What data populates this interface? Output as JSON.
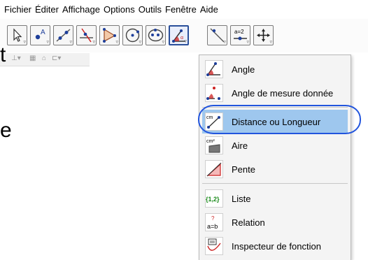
{
  "menubar": {
    "items": [
      "Fichier",
      "Éditer",
      "Affichage",
      "Options",
      "Outils",
      "Fenêtre",
      "Aide"
    ]
  },
  "toolbar": {
    "tools": [
      {
        "name": "move-tool-button",
        "icon": "cursor-arrow-icon"
      },
      {
        "name": "point-tool-button",
        "icon": "point-A-icon"
      },
      {
        "name": "line-tool-button",
        "icon": "line-icon"
      },
      {
        "name": "perpendicular-tool-button",
        "icon": "perpendicular-icon"
      },
      {
        "name": "polygon-tool-button",
        "icon": "polygon-icon"
      },
      {
        "name": "circle-tool-button",
        "icon": "circle-icon"
      },
      {
        "name": "conic-tool-button",
        "icon": "ellipse-icon"
      },
      {
        "name": "angle-tool-button",
        "icon": "angle-icon",
        "selected": true
      },
      {
        "name": "reflect-tool-button",
        "icon": "reflect-icon"
      },
      {
        "name": "slider-tool-button",
        "icon": "slider-icon",
        "text": "a=2"
      },
      {
        "name": "move-view-tool-button",
        "icon": "move-graphics-view-icon"
      }
    ]
  },
  "fragments": {
    "t": "t",
    "e": "e"
  },
  "dropdown": {
    "items": [
      {
        "label": "Angle",
        "icon": "angle-icon"
      },
      {
        "label": "Angle de mesure donnée",
        "icon": "angle-given-size-icon"
      },
      {
        "label": "Distance ou Longueur",
        "icon": "distance-length-icon",
        "icon_text": "cm",
        "highlighted": true
      },
      {
        "label": "Aire",
        "icon": "area-icon",
        "icon_text": "cm²"
      },
      {
        "label": "Pente",
        "icon": "slope-icon"
      },
      {
        "label": "Liste",
        "icon": "list-icon",
        "icon_text": "{1,2}"
      },
      {
        "label": "Relation",
        "icon": "relation-icon",
        "icon_text": "a=b"
      },
      {
        "label": "Inspecteur de fonction",
        "icon": "function-inspector-icon"
      }
    ]
  },
  "colors": {
    "highlight": "#9ec7ee",
    "annotation": "#2255dd",
    "accent_blue": "#1e3f9a",
    "accent_red": "#cc2222",
    "list_green": "#1a8a1a"
  }
}
